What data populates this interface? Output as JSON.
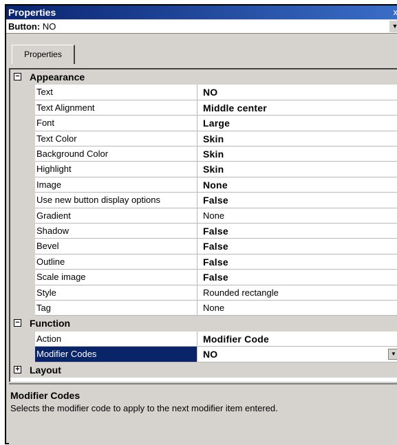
{
  "window": {
    "title": "Properties",
    "close_glyph": "x"
  },
  "selector": {
    "type_label": "Button:",
    "object_name": "NO"
  },
  "tabs": [
    {
      "label": "Properties",
      "active": true
    }
  ],
  "groups": [
    {
      "name": "Appearance",
      "expanded": true,
      "toggle_glyph": "−",
      "rows": [
        {
          "name": "Text",
          "value": "NO",
          "bold": true
        },
        {
          "name": "Text Alignment",
          "value": "Middle center",
          "bold": true
        },
        {
          "name": "Font",
          "value": "Large",
          "bold": true
        },
        {
          "name": "Text Color",
          "value": "Skin",
          "bold": true
        },
        {
          "name": "Background Color",
          "value": "Skin",
          "bold": true
        },
        {
          "name": "Highlight",
          "value": "Skin",
          "bold": true
        },
        {
          "name": "Image",
          "value": "None",
          "bold": true
        },
        {
          "name": "Use new button display options",
          "value": "False",
          "bold": true
        },
        {
          "name": "Gradient",
          "value": "None",
          "bold": false
        },
        {
          "name": "Shadow",
          "value": "False",
          "bold": true
        },
        {
          "name": "Bevel",
          "value": "False",
          "bold": true
        },
        {
          "name": "Outline",
          "value": "False",
          "bold": true
        },
        {
          "name": "Scale image",
          "value": "False",
          "bold": true
        },
        {
          "name": "Style",
          "value": "Rounded rectangle",
          "bold": false
        },
        {
          "name": "Tag",
          "value": "None",
          "bold": false
        }
      ]
    },
    {
      "name": "Function",
      "expanded": true,
      "toggle_glyph": "−",
      "rows": [
        {
          "name": "Action",
          "value": "Modifier Code",
          "bold": true
        },
        {
          "name": "Modifier Codes",
          "value": "NO",
          "bold": true,
          "selected": true
        }
      ]
    },
    {
      "name": "Layout",
      "expanded": false,
      "toggle_glyph": "+",
      "rows": []
    }
  ],
  "description": {
    "title": "Modifier Codes",
    "text": "Selects the modifier code to apply to the next modifier item entered."
  },
  "colors": {
    "titlebar_start": "#0a2470",
    "titlebar_end": "#3a6ec8",
    "selection": "#0a246a",
    "panel": "#d6d3ce"
  },
  "icons": {
    "dropdown": "chevron-down-icon",
    "expand": "plus-icon",
    "collapse": "minus-icon"
  }
}
